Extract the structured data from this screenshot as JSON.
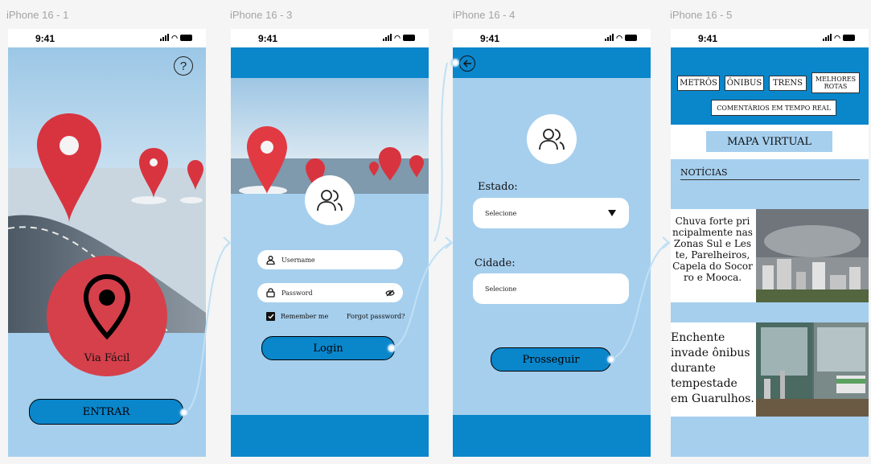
{
  "frames": [
    {
      "label": "iPhone 16 - 1"
    },
    {
      "label": "iPhone 16 - 3"
    },
    {
      "label": "iPhone 16 - 4"
    },
    {
      "label": "iPhone 16 - 5"
    }
  ],
  "status": {
    "time": "9:41"
  },
  "colors": {
    "accent": "#0a86cb",
    "light_blue": "#a6cfee",
    "brand_red": "#d6404b"
  },
  "screen1": {
    "help_icon": "?",
    "logo_caption": "Via Fácil",
    "enter_button": "ENTRAR"
  },
  "screen3": {
    "username_placeholder": "Username",
    "password_placeholder": "Password",
    "remember_label": "Remember me",
    "forgot_label": "Forgot password?",
    "login_button": "Login"
  },
  "screen4": {
    "state_label": "Estado:",
    "state_select_value": "Selecione",
    "city_label": "Cidade:",
    "city_select_value": "Selecione",
    "continue_button": "Prosseguir"
  },
  "screen5": {
    "nav_items": [
      "METRÔS",
      "ÔNIBUS",
      "TRENS",
      "MELHORES ROTAS"
    ],
    "realtime_comments": "COMENTÁRIOS EM TEMPO REAL",
    "map_button": "MAPA VIRTUAL",
    "news_header": "NOTÍCIAS",
    "news": [
      {
        "text": "Chuva forte principalmente nas Zonas Sul e Leste, Parelheiros, Capela do Socorro e Mooca."
      },
      {
        "text": "Enchente invade ônibus durante tempestade em Guarulhos."
      }
    ]
  }
}
